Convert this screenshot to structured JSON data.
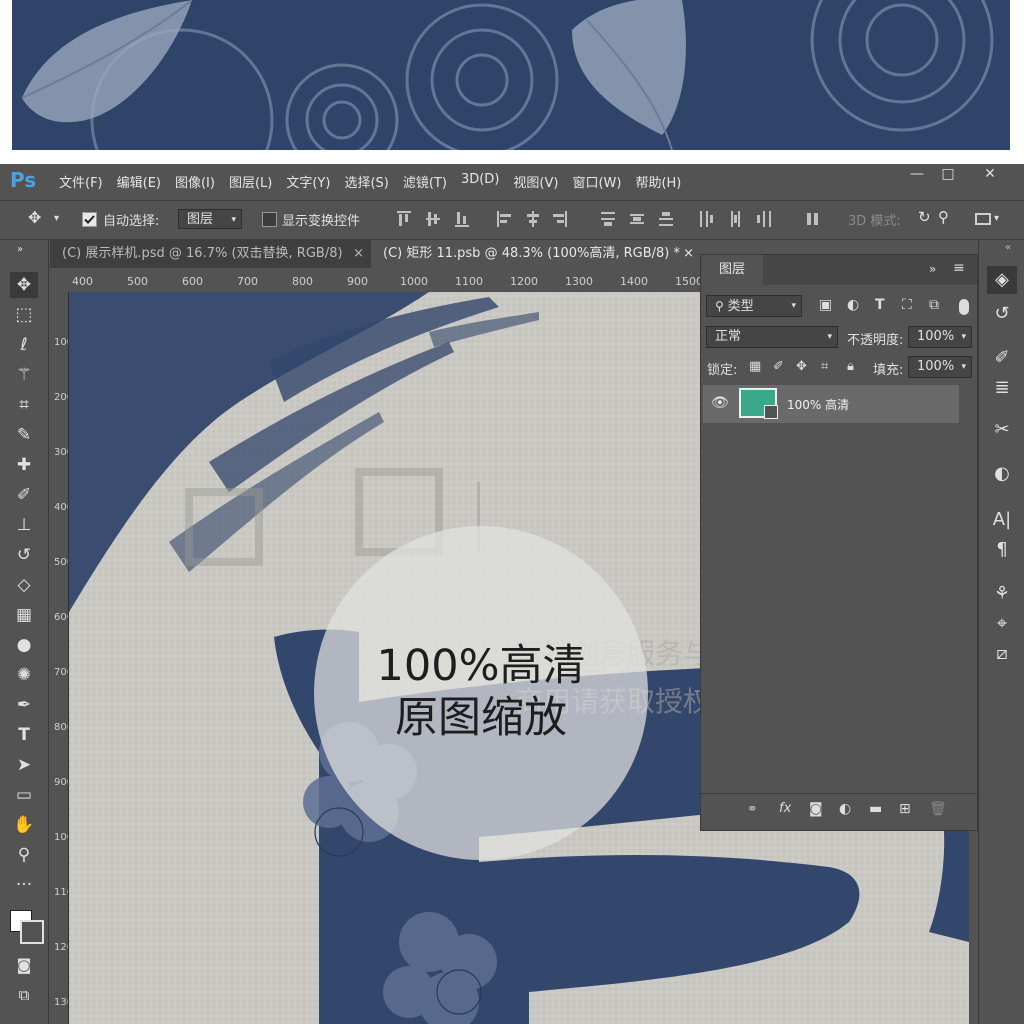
{
  "menubar": {
    "logo": "Ps",
    "items": [
      "文件(F)",
      "编辑(E)",
      "图像(I)",
      "图层(L)",
      "文字(Y)",
      "选择(S)",
      "滤镜(T)",
      "3D(D)",
      "视图(V)",
      "窗口(W)",
      "帮助(H)"
    ],
    "minimize": "—",
    "restore": "□",
    "close": "✕"
  },
  "options": {
    "auto_select_label": "自动选择:",
    "auto_select_target": "图层",
    "show_transform_label": "显示变换控件",
    "mode_3d_label": "3D 模式:"
  },
  "tabs": [
    {
      "label": "(C) 展示样机.psd @ 16.7% (双击替换, RGB/8)",
      "close": "×"
    },
    {
      "label": "(C) 矩形 11.psb @ 48.3% (100%高清, RGB/8) *",
      "close": "×"
    }
  ],
  "ruler": {
    "top_ticks": [
      "400",
      "500",
      "600",
      "700",
      "800",
      "900",
      "1000",
      "1100",
      "1200",
      "1300",
      "1400",
      "1500"
    ],
    "left_ticks": [
      "100",
      "200",
      "300",
      "400",
      "500",
      "600",
      "700",
      "800",
      "900",
      "1000",
      "1100",
      "1200",
      "1300"
    ]
  },
  "layers_panel": {
    "title": "图层",
    "filter_kind": "类型",
    "blend_mode": "正常",
    "opacity_label": "不透明度:",
    "opacity_value": "100%",
    "lock_label": "锁定:",
    "fill_label": "填充:",
    "fill_value": "100%",
    "layer_name": "100% 高清",
    "thumbnail_color": "#3aa98a"
  },
  "canvas": {
    "badge_line1": "100%高清",
    "badge_line2": "原图缩放",
    "watermark_line1": "营销创意服务与协作平台",
    "watermark_line2": "商用请获取授权"
  },
  "colors": {
    "banner_navy": "#2f4468",
    "ps_accent": "#4aa3df",
    "layer_green": "#3aa98a"
  }
}
